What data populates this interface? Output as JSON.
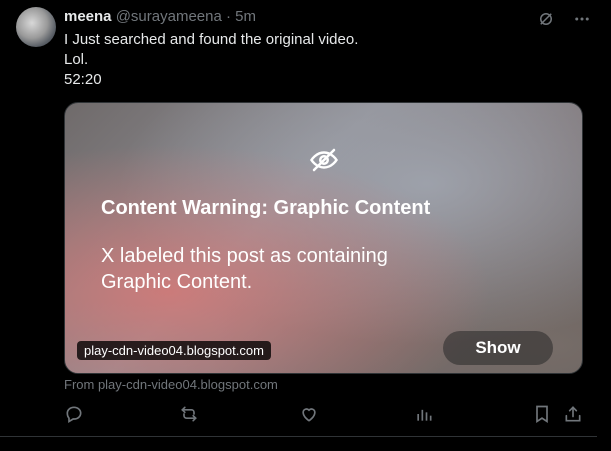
{
  "post": {
    "author_name": "meena",
    "author_handle": "@surayameena",
    "separator": "·",
    "time": "5m",
    "text_lines": [
      "I Just searched and found the original video.",
      "Lol.",
      "52:20"
    ]
  },
  "top_icons": [
    "grok-icon",
    "more-icon"
  ],
  "media": {
    "warning_icon": "eye-off-icon",
    "warning_title": "Content Warning: Graphic Content",
    "warning_body": "X labeled this post as containing Graphic Content.",
    "domain_overlay": "play-cdn-video04.blogspot.com",
    "show_label": "Show"
  },
  "source_caption": "From play-cdn-video04.blogspot.com",
  "actions": [
    "reply-icon",
    "repost-icon",
    "like-icon",
    "views-icon",
    "bookmark-icon",
    "share-icon"
  ],
  "colors": {
    "background": "#000000",
    "primary_text": "#e7e9ea",
    "secondary_text": "#71767b",
    "border": "#2f3336"
  }
}
